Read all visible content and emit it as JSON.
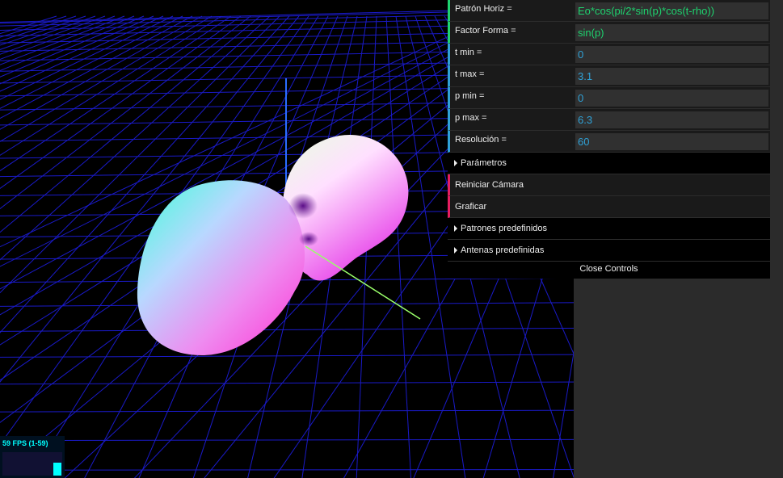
{
  "controls": {
    "params": [
      {
        "label": "Patrón Horiz =",
        "value": "Eo*cos(pi/2*sin(p)*cos(t-rho))",
        "kind": "str"
      },
      {
        "label": "Factor Forma =",
        "value": "sin(p)",
        "kind": "str"
      },
      {
        "label": "t min =",
        "value": "0",
        "kind": "num"
      },
      {
        "label": "t max =",
        "value": "3.1",
        "kind": "num"
      },
      {
        "label": "p min =",
        "value": "0",
        "kind": "num"
      },
      {
        "label": "p max =",
        "value": "6.3",
        "kind": "num"
      },
      {
        "label": "Resolución =",
        "value": "60",
        "kind": "num"
      }
    ],
    "folder_parametros": "Parámetros",
    "reset_camera": "Reiniciar Cámara",
    "plot": "Graficar",
    "folder_patrones": "Patrones predefinidos",
    "folder_antenas": "Antenas predefinidas",
    "close": "Close Controls"
  },
  "stats": {
    "fps_text": "59 FPS (1-59)",
    "fps_level": 0.55
  },
  "colors": {
    "grid": "#1a1ac8",
    "string_accent": "#1ed36f",
    "number_accent": "#2fa1d6",
    "function_accent": "#e61d5f",
    "axis_z": "#2a6cff",
    "axis_x": "#9aff6a"
  },
  "icons": {
    "folder_caret": "caret-right-icon"
  }
}
